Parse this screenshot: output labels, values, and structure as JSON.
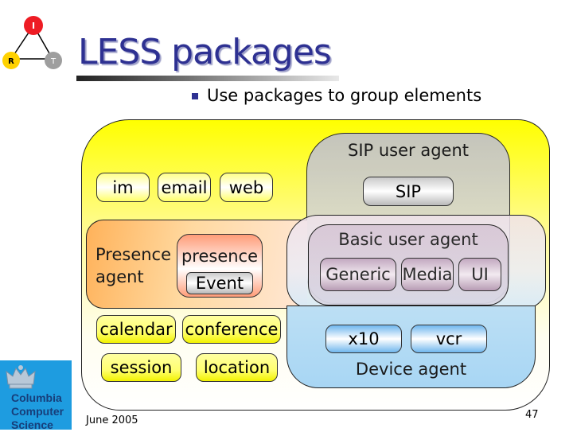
{
  "slide": {
    "title": "LESS packages",
    "bullets": [
      "Use packages to group elements"
    ],
    "footer_date": "June 2005",
    "page_number": "47",
    "colors": {
      "title": "#2e3192",
      "outer_package": "#ffff00",
      "sip_user_agent": "#c2c2c2",
      "presence_agent": "#ffb25a",
      "device_agent": "#a8d6f4",
      "basic_user_agent": "#c8b2c8"
    }
  },
  "logo": {
    "nodes": [
      {
        "letter": "I",
        "color": "#ee1c24"
      },
      {
        "letter": "R",
        "color": "#ffd200"
      },
      {
        "letter": "T",
        "color": "#9e9e9e"
      }
    ]
  },
  "institution": {
    "lines": [
      "Columbia",
      "Computer",
      "Science"
    ],
    "icon": "crown-icon"
  },
  "diagram": {
    "top_packages": [
      "im",
      "email",
      "web"
    ],
    "sip_user_agent": {
      "label": "SIP user agent",
      "packages": [
        "SIP"
      ]
    },
    "presence_agent": {
      "label_line1": "Presence",
      "label_line2": "agent",
      "presence_package": {
        "label": "presence",
        "packages": [
          "Event"
        ]
      }
    },
    "basic_user_agent": {
      "label": "Basic user agent",
      "packages": [
        "Generic",
        "Media",
        "UI"
      ]
    },
    "bottom_packages_row1": [
      "calendar",
      "conference"
    ],
    "bottom_packages_row2": [
      "session",
      "location"
    ],
    "device_agent": {
      "label": "Device agent",
      "packages": [
        "x10",
        "vcr"
      ]
    }
  }
}
